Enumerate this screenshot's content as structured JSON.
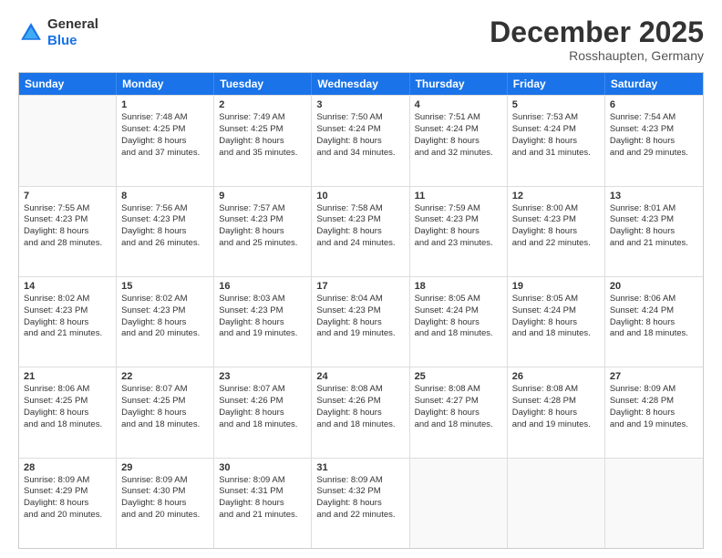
{
  "logo": {
    "line1": "General",
    "line2": "Blue"
  },
  "title": "December 2025",
  "location": "Rosshaupten, Germany",
  "header_days": [
    "Sunday",
    "Monday",
    "Tuesday",
    "Wednesday",
    "Thursday",
    "Friday",
    "Saturday"
  ],
  "weeks": [
    [
      {
        "day": "",
        "sunrise": "",
        "sunset": "",
        "daylight": ""
      },
      {
        "day": "1",
        "sunrise": "Sunrise: 7:48 AM",
        "sunset": "Sunset: 4:25 PM",
        "daylight": "Daylight: 8 hours and 37 minutes."
      },
      {
        "day": "2",
        "sunrise": "Sunrise: 7:49 AM",
        "sunset": "Sunset: 4:25 PM",
        "daylight": "Daylight: 8 hours and 35 minutes."
      },
      {
        "day": "3",
        "sunrise": "Sunrise: 7:50 AM",
        "sunset": "Sunset: 4:24 PM",
        "daylight": "Daylight: 8 hours and 34 minutes."
      },
      {
        "day": "4",
        "sunrise": "Sunrise: 7:51 AM",
        "sunset": "Sunset: 4:24 PM",
        "daylight": "Daylight: 8 hours and 32 minutes."
      },
      {
        "day": "5",
        "sunrise": "Sunrise: 7:53 AM",
        "sunset": "Sunset: 4:24 PM",
        "daylight": "Daylight: 8 hours and 31 minutes."
      },
      {
        "day": "6",
        "sunrise": "Sunrise: 7:54 AM",
        "sunset": "Sunset: 4:23 PM",
        "daylight": "Daylight: 8 hours and 29 minutes."
      }
    ],
    [
      {
        "day": "7",
        "sunrise": "Sunrise: 7:55 AM",
        "sunset": "Sunset: 4:23 PM",
        "daylight": "Daylight: 8 hours and 28 minutes."
      },
      {
        "day": "8",
        "sunrise": "Sunrise: 7:56 AM",
        "sunset": "Sunset: 4:23 PM",
        "daylight": "Daylight: 8 hours and 26 minutes."
      },
      {
        "day": "9",
        "sunrise": "Sunrise: 7:57 AM",
        "sunset": "Sunset: 4:23 PM",
        "daylight": "Daylight: 8 hours and 25 minutes."
      },
      {
        "day": "10",
        "sunrise": "Sunrise: 7:58 AM",
        "sunset": "Sunset: 4:23 PM",
        "daylight": "Daylight: 8 hours and 24 minutes."
      },
      {
        "day": "11",
        "sunrise": "Sunrise: 7:59 AM",
        "sunset": "Sunset: 4:23 PM",
        "daylight": "Daylight: 8 hours and 23 minutes."
      },
      {
        "day": "12",
        "sunrise": "Sunrise: 8:00 AM",
        "sunset": "Sunset: 4:23 PM",
        "daylight": "Daylight: 8 hours and 22 minutes."
      },
      {
        "day": "13",
        "sunrise": "Sunrise: 8:01 AM",
        "sunset": "Sunset: 4:23 PM",
        "daylight": "Daylight: 8 hours and 21 minutes."
      }
    ],
    [
      {
        "day": "14",
        "sunrise": "Sunrise: 8:02 AM",
        "sunset": "Sunset: 4:23 PM",
        "daylight": "Daylight: 8 hours and 21 minutes."
      },
      {
        "day": "15",
        "sunrise": "Sunrise: 8:02 AM",
        "sunset": "Sunset: 4:23 PM",
        "daylight": "Daylight: 8 hours and 20 minutes."
      },
      {
        "day": "16",
        "sunrise": "Sunrise: 8:03 AM",
        "sunset": "Sunset: 4:23 PM",
        "daylight": "Daylight: 8 hours and 19 minutes."
      },
      {
        "day": "17",
        "sunrise": "Sunrise: 8:04 AM",
        "sunset": "Sunset: 4:23 PM",
        "daylight": "Daylight: 8 hours and 19 minutes."
      },
      {
        "day": "18",
        "sunrise": "Sunrise: 8:05 AM",
        "sunset": "Sunset: 4:24 PM",
        "daylight": "Daylight: 8 hours and 18 minutes."
      },
      {
        "day": "19",
        "sunrise": "Sunrise: 8:05 AM",
        "sunset": "Sunset: 4:24 PM",
        "daylight": "Daylight: 8 hours and 18 minutes."
      },
      {
        "day": "20",
        "sunrise": "Sunrise: 8:06 AM",
        "sunset": "Sunset: 4:24 PM",
        "daylight": "Daylight: 8 hours and 18 minutes."
      }
    ],
    [
      {
        "day": "21",
        "sunrise": "Sunrise: 8:06 AM",
        "sunset": "Sunset: 4:25 PM",
        "daylight": "Daylight: 8 hours and 18 minutes."
      },
      {
        "day": "22",
        "sunrise": "Sunrise: 8:07 AM",
        "sunset": "Sunset: 4:25 PM",
        "daylight": "Daylight: 8 hours and 18 minutes."
      },
      {
        "day": "23",
        "sunrise": "Sunrise: 8:07 AM",
        "sunset": "Sunset: 4:26 PM",
        "daylight": "Daylight: 8 hours and 18 minutes."
      },
      {
        "day": "24",
        "sunrise": "Sunrise: 8:08 AM",
        "sunset": "Sunset: 4:26 PM",
        "daylight": "Daylight: 8 hours and 18 minutes."
      },
      {
        "day": "25",
        "sunrise": "Sunrise: 8:08 AM",
        "sunset": "Sunset: 4:27 PM",
        "daylight": "Daylight: 8 hours and 18 minutes."
      },
      {
        "day": "26",
        "sunrise": "Sunrise: 8:08 AM",
        "sunset": "Sunset: 4:28 PM",
        "daylight": "Daylight: 8 hours and 19 minutes."
      },
      {
        "day": "27",
        "sunrise": "Sunrise: 8:09 AM",
        "sunset": "Sunset: 4:28 PM",
        "daylight": "Daylight: 8 hours and 19 minutes."
      }
    ],
    [
      {
        "day": "28",
        "sunrise": "Sunrise: 8:09 AM",
        "sunset": "Sunset: 4:29 PM",
        "daylight": "Daylight: 8 hours and 20 minutes."
      },
      {
        "day": "29",
        "sunrise": "Sunrise: 8:09 AM",
        "sunset": "Sunset: 4:30 PM",
        "daylight": "Daylight: 8 hours and 20 minutes."
      },
      {
        "day": "30",
        "sunrise": "Sunrise: 8:09 AM",
        "sunset": "Sunset: 4:31 PM",
        "daylight": "Daylight: 8 hours and 21 minutes."
      },
      {
        "day": "31",
        "sunrise": "Sunrise: 8:09 AM",
        "sunset": "Sunset: 4:32 PM",
        "daylight": "Daylight: 8 hours and 22 minutes."
      },
      {
        "day": "",
        "sunrise": "",
        "sunset": "",
        "daylight": ""
      },
      {
        "day": "",
        "sunrise": "",
        "sunset": "",
        "daylight": ""
      },
      {
        "day": "",
        "sunrise": "",
        "sunset": "",
        "daylight": ""
      }
    ]
  ]
}
